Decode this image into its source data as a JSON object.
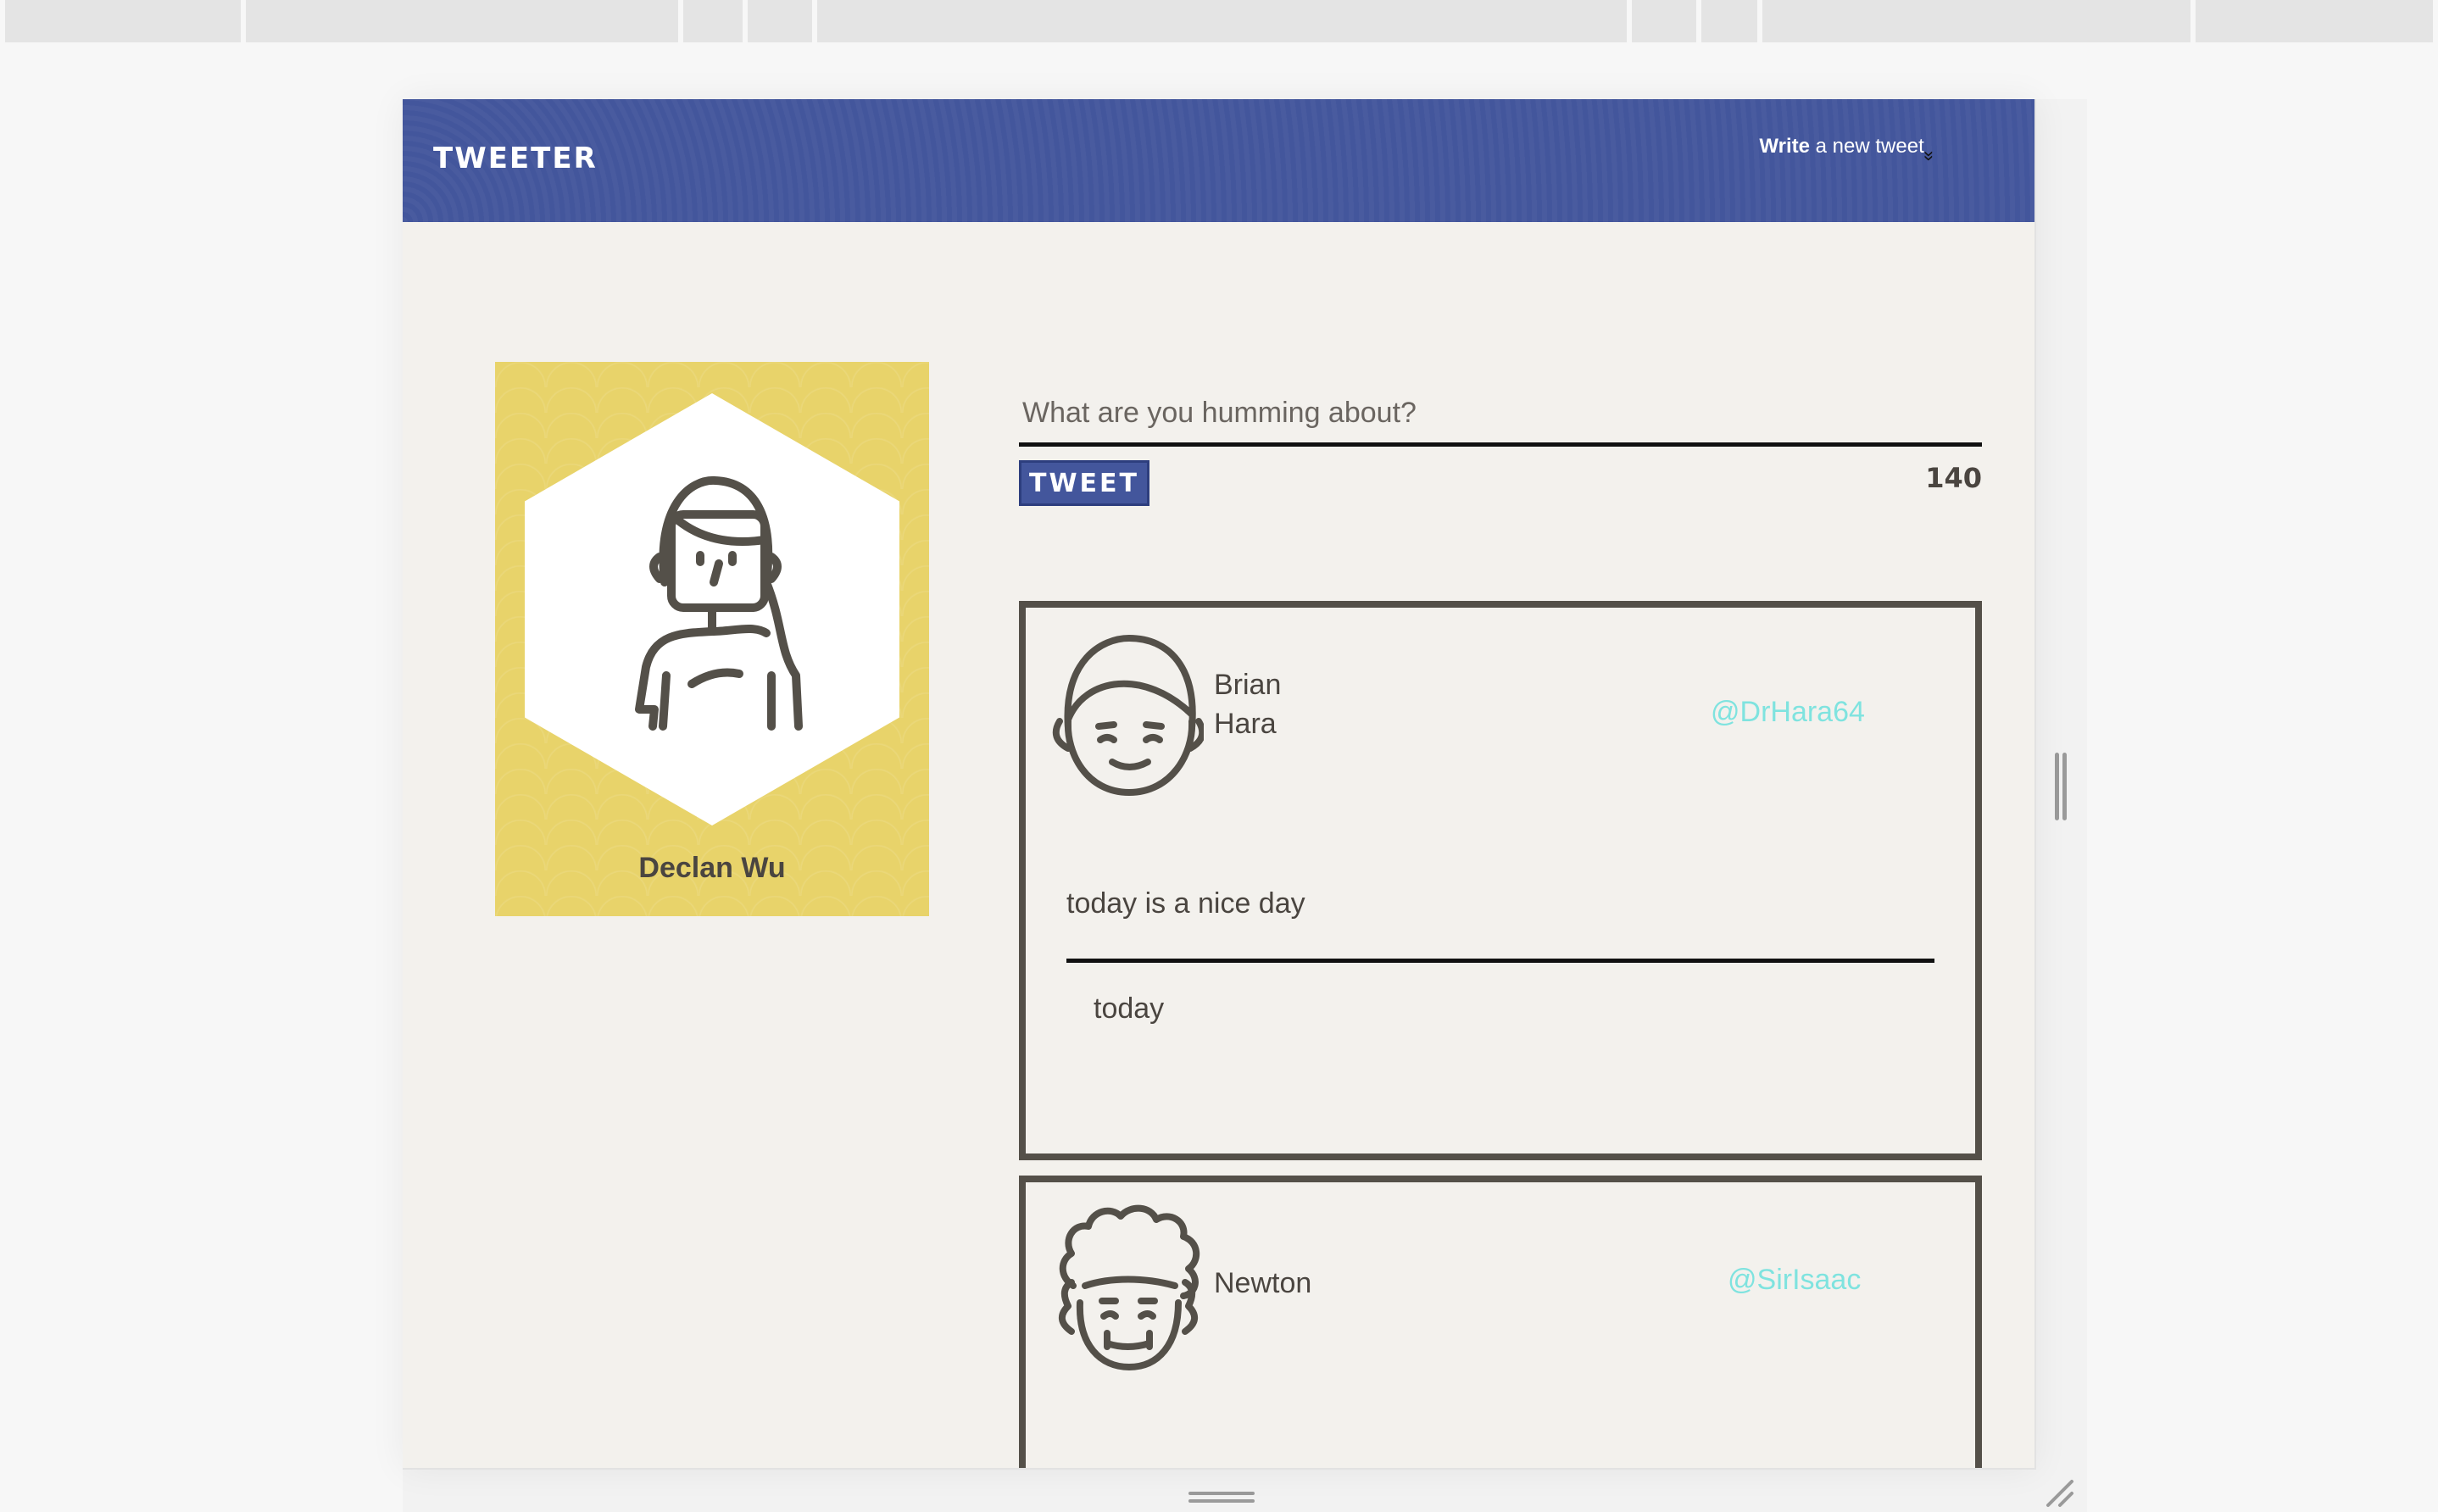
{
  "app": {
    "brand": "TWEETER"
  },
  "nav": {
    "compose_strong": "Write",
    "compose_rest": " a new tweet",
    "compose_chevron": "»"
  },
  "profile": {
    "name": "Declan Wu",
    "avatar_icon": "woman-avatar-icon"
  },
  "composer": {
    "placeholder": "What are you humming about?",
    "value": "",
    "submit_label": "Tweet",
    "char_counter": "140"
  },
  "tweets": [
    {
      "name_line1": "Brian",
      "name_line2": "Hara",
      "handle": "@DrHara64",
      "content": "today is a nice day",
      "time": "today",
      "avatar_icon": "man-avatar-icon"
    },
    {
      "name_line1": "Newton",
      "name_line2": "",
      "handle": "@SirIsaac",
      "content": "",
      "time": "",
      "avatar_icon": "curly-hair-avatar-icon"
    }
  ],
  "colors": {
    "nav_bg": "#43569c",
    "profile_bg": "#e8d36a",
    "handle": "#7fe3df",
    "border": "#545049"
  }
}
